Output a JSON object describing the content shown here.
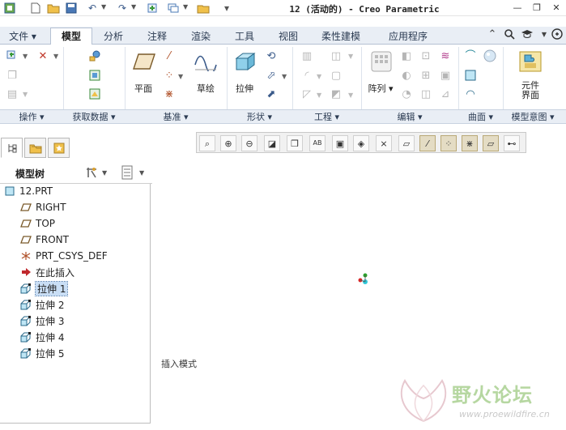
{
  "window": {
    "title": "12 (活动的) - Creo Parametric",
    "controls": [
      "minimize-icon",
      "restore-icon",
      "close-icon"
    ]
  },
  "quick_access": [
    "app-icon",
    "new-icon",
    "open-icon",
    "save-icon",
    "undo-icon",
    "redo-icon",
    "regenerate-icon",
    "windows-icon",
    "close-window-icon",
    "customize-icon"
  ],
  "tabs": [
    {
      "label": "文件"
    },
    {
      "label": "模型"
    },
    {
      "label": "分析"
    },
    {
      "label": "注释"
    },
    {
      "label": "渲染"
    },
    {
      "label": "工具"
    },
    {
      "label": "视图"
    },
    {
      "label": "柔性建模"
    },
    {
      "label": "应用程序"
    }
  ],
  "tab_icons": [
    "expand-icon",
    "search-icon",
    "help-icon",
    "minimize-ribbon-icon"
  ],
  "ribbon": {
    "datum": {
      "plane": "平面",
      "sketch": "草绘"
    },
    "shapes": {
      "extrude": "拉伸"
    },
    "editing": {
      "pattern": "阵列"
    },
    "model_intent": {
      "component_interface": "元件\n界面"
    }
  },
  "groups": [
    {
      "label": "操作"
    },
    {
      "label": "获取数据"
    },
    {
      "label": "基准"
    },
    {
      "label": "形状"
    },
    {
      "label": "工程"
    },
    {
      "label": "编辑"
    },
    {
      "label": "曲面"
    },
    {
      "label": "模型意图"
    }
  ],
  "view_toolbar": [
    "refit-icon",
    "zoom-in-icon",
    "zoom-out-icon",
    "repaint-icon",
    "display-style-icon",
    "saved-views-icon",
    "view-manager-icon",
    "perspective-icon",
    "plane-display-icon",
    "axis-display-icon",
    "point-display-icon",
    "csys-display-icon",
    "annotation-display-icon",
    "spin-center-icon"
  ],
  "nav_tabs": [
    "model-tree-tab",
    "folder-browser-tab",
    "favorites-tab"
  ],
  "model_tree": {
    "title": "模型树",
    "nodes": [
      {
        "label": "12.PRT",
        "icon": "part-icon",
        "indent": 0
      },
      {
        "label": "RIGHT",
        "icon": "datum-plane-icon",
        "indent": 1
      },
      {
        "label": "TOP",
        "icon": "datum-plane-icon",
        "indent": 1
      },
      {
        "label": "FRONT",
        "icon": "datum-plane-icon",
        "indent": 1
      },
      {
        "label": "PRT_CSYS_DEF",
        "icon": "csys-icon",
        "indent": 1
      },
      {
        "label": "在此插入",
        "icon": "insert-here-arrow-icon",
        "indent": 1
      },
      {
        "label": "拉伸 1",
        "icon": "extrude-feature-icon",
        "indent": 1,
        "selected": true
      },
      {
        "label": "拉伸 2",
        "icon": "extrude-feature-icon",
        "indent": 1
      },
      {
        "label": "拉伸 3",
        "icon": "extrude-feature-icon",
        "indent": 1
      },
      {
        "label": "拉伸 4",
        "icon": "extrude-feature-icon",
        "indent": 1
      },
      {
        "label": "拉伸 5",
        "icon": "extrude-feature-icon",
        "indent": 1
      }
    ]
  },
  "status_text": "插入模式",
  "watermark": {
    "text": "野火论坛",
    "url": "www.proewildfire.cn"
  },
  "colors": {
    "tab_bar": "#e9eef5",
    "selection": "#c9def5",
    "watermark": "#b6d7a1"
  }
}
